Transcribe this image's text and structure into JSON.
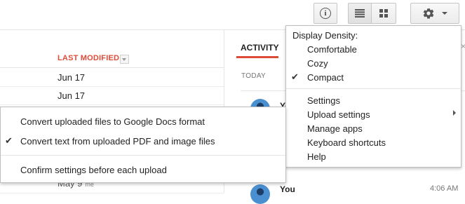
{
  "toolbar": {
    "info_icon": "info-icon",
    "info_glyph": "i",
    "list_view_icon": "list-view-icon",
    "grid_view_icon": "grid-view-icon",
    "settings_icon": "gear-icon",
    "settings_caret_icon": "caret-down-icon"
  },
  "file_list": {
    "column_last_modified": "LAST MODIFIED",
    "rows": [
      {
        "date": "Jun 17"
      },
      {
        "date": "Jun 17"
      },
      {
        "date": "May 9",
        "owner": "me"
      }
    ]
  },
  "activity": {
    "tab_label": "ACTIVITY",
    "section_label": "TODAY",
    "items": [
      {
        "actor": "Yo"
      },
      {
        "actor": "You",
        "time": "4:06 AM"
      }
    ]
  },
  "settings_menu": {
    "density_heading": "Display Density:",
    "density_options": [
      {
        "label": "Comfortable",
        "checked": false
      },
      {
        "label": "Cozy",
        "checked": false
      },
      {
        "label": "Compact",
        "checked": true
      }
    ],
    "items": [
      {
        "label": "Settings"
      },
      {
        "label": "Upload settings",
        "has_submenu": true,
        "highlighted": true
      },
      {
        "label": "Manage apps"
      },
      {
        "label": "Keyboard shortcuts"
      },
      {
        "label": "Help"
      }
    ],
    "check_glyph": "✔"
  },
  "upload_submenu": {
    "items": [
      {
        "label": "Convert uploaded files to Google Docs format",
        "checked": false
      },
      {
        "label": "Convert text from uploaded PDF and image files",
        "checked": true
      },
      {
        "label": "Confirm settings before each upload",
        "checked": false
      }
    ]
  },
  "colors": {
    "accent_red": "#dd4b39",
    "menu_border": "#bfbfbf"
  }
}
